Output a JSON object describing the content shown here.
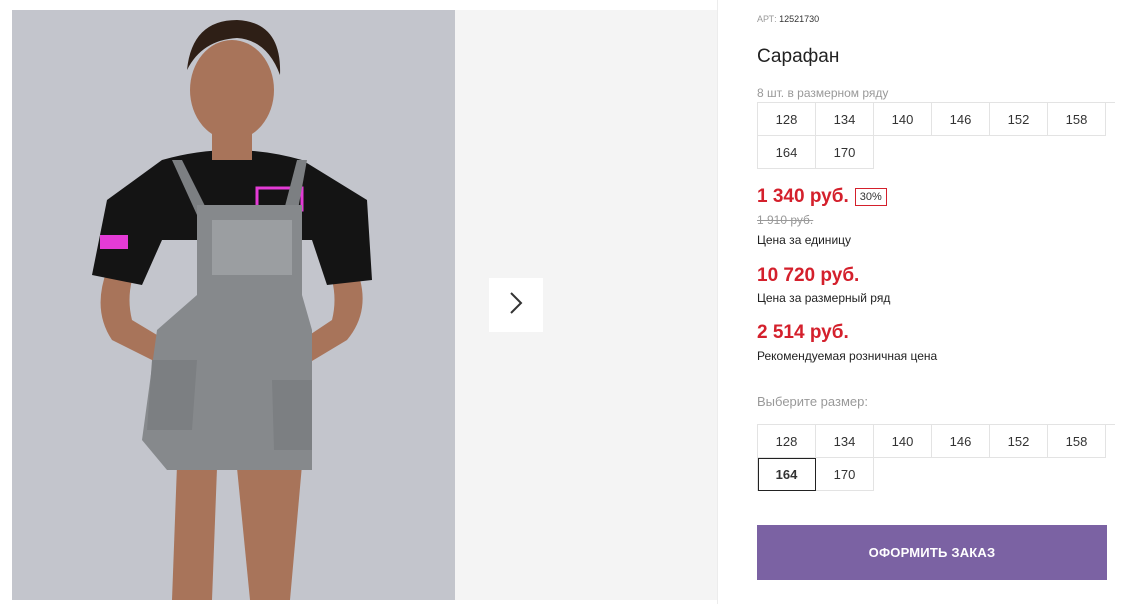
{
  "product": {
    "sku_label": "АРТ:",
    "sku_value": "12521730",
    "title": "Сарафан",
    "range_label": "8 шт. в размерном ряду",
    "range_sizes": [
      "128",
      "134",
      "140",
      "146",
      "152",
      "158",
      "164",
      "170"
    ]
  },
  "prices": {
    "unit_price": "1 340 руб.",
    "discount_badge": "30%",
    "old_price": "1 910 руб.",
    "unit_caption": "Цена за единицу",
    "range_price": "10 720 руб.",
    "range_caption": "Цена за размерный ряд",
    "retail_price": "2 514 руб.",
    "retail_caption": "Рекомендуемая розничная цена"
  },
  "size_picker": {
    "label": "Выберите размер:",
    "sizes": [
      "128",
      "134",
      "140",
      "146",
      "152",
      "158",
      "164",
      "170"
    ],
    "selected": "164"
  },
  "actions": {
    "order_label": "ОФОРМИТЬ ЗАКАЗ"
  },
  "colors": {
    "price_red": "#d4202c",
    "order_button": "#7b62a3"
  },
  "icons": {
    "next": "chevron-right-icon"
  }
}
